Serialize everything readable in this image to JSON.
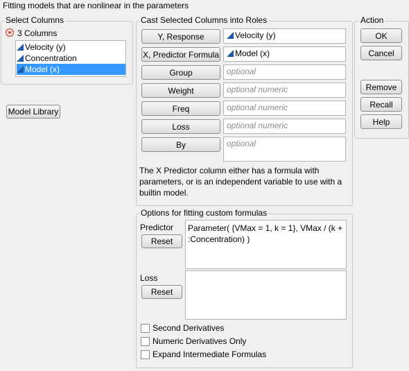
{
  "window_title": "Fitting models that are nonlinear in the parameters",
  "select_columns": {
    "title": "Select Columns",
    "count_label": "3 Columns",
    "columns": [
      "Velocity (y)",
      "Concentration",
      "Model (x)"
    ]
  },
  "model_library_label": "Model Library",
  "roles": {
    "title": "Cast Selected Columns into Roles",
    "y_label": "Y, Response",
    "y_value": "Velocity (y)",
    "x_label": "X, Predictor Formula",
    "x_value": "Model (x)",
    "group_label": "Group",
    "group_placeholder": "optional",
    "weight_label": "Weight",
    "weight_placeholder": "optional numeric",
    "freq_label": "Freq",
    "freq_placeholder": "optional numeric",
    "loss_label": "Loss",
    "loss_placeholder": "optional numeric",
    "by_label": "By",
    "by_placeholder": "optional",
    "note": "The X Predictor column either has a formula with parameters, or is an independent variable to use with a builtin model."
  },
  "action": {
    "title": "Action",
    "ok": "OK",
    "cancel": "Cancel",
    "remove": "Remove",
    "recall": "Recall",
    "help": "Help"
  },
  "options": {
    "title": "Options for fitting custom formulas",
    "predictor_label": "Predictor",
    "predictor_reset": "Reset",
    "predictor_formula": "Parameter( {VMax = 1, k = 1}, VMax / (k + :Concentration) )",
    "loss_label": "Loss",
    "loss_reset": "Reset",
    "loss_formula": "",
    "checkboxes": [
      "Second Derivatives",
      "Numeric Derivatives Only",
      "Expand Intermediate Formulas"
    ]
  },
  "colors": {
    "accent": "#3399ff",
    "column_icon": "#1f5aa6"
  }
}
